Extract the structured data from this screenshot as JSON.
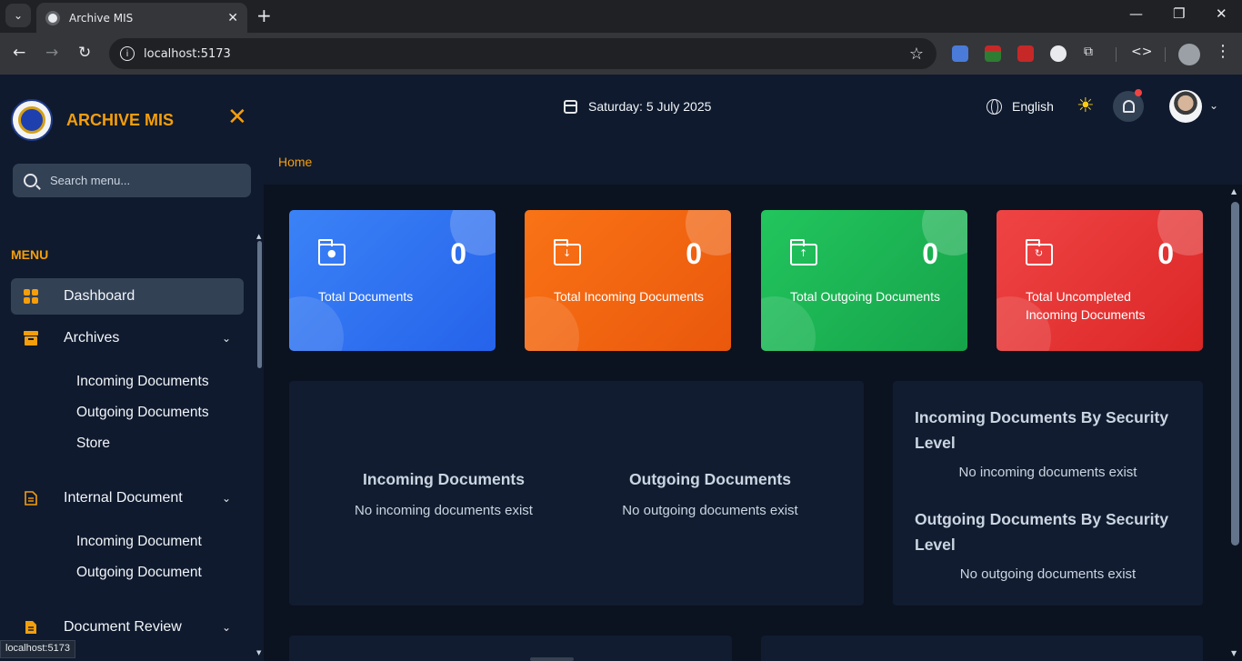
{
  "browser": {
    "tab_title": "Archive MIS",
    "url": "localhost:5173",
    "status_url": "localhost:5173"
  },
  "sidebar": {
    "app_title": "ARCHIVE MIS",
    "search_placeholder": "Search menu...",
    "menu_label": "MENU",
    "items": [
      {
        "label": "Dashboard",
        "icon": "grid-icon",
        "active": true
      },
      {
        "label": "Archives",
        "icon": "archive-box-icon",
        "children": [
          "Incoming Documents",
          "Outgoing Documents",
          "Store"
        ]
      },
      {
        "label": "Internal Document",
        "icon": "document-icon",
        "children": [
          "Incoming Document",
          "Outgoing Document"
        ]
      },
      {
        "label": "Document Review",
        "icon": "document-filled-icon"
      }
    ]
  },
  "header": {
    "date": "Saturday: 5 July 2025",
    "language": "English"
  },
  "breadcrumb": "Home",
  "stats": [
    {
      "label": "Total Documents",
      "value": "0",
      "color": "#3b82f6"
    },
    {
      "label": "Total Incoming Documents",
      "value": "0",
      "color": "#f97316"
    },
    {
      "label": "Total Outgoing Documents",
      "value": "0",
      "color": "#22c55e"
    },
    {
      "label": "Total Uncompleted Incoming Documents",
      "value": "0",
      "color": "#ef4444"
    }
  ],
  "overview": {
    "incoming_title": "Incoming Documents",
    "incoming_empty": "No incoming documents exist",
    "outgoing_title": "Outgoing Documents",
    "outgoing_empty": "No outgoing documents exist"
  },
  "security": {
    "incoming_title": "Incoming Documents By Security Level",
    "incoming_empty": "No incoming documents exist",
    "outgoing_title": "Outgoing Documents By Security Level",
    "outgoing_empty": "No outgoing documents exist"
  }
}
